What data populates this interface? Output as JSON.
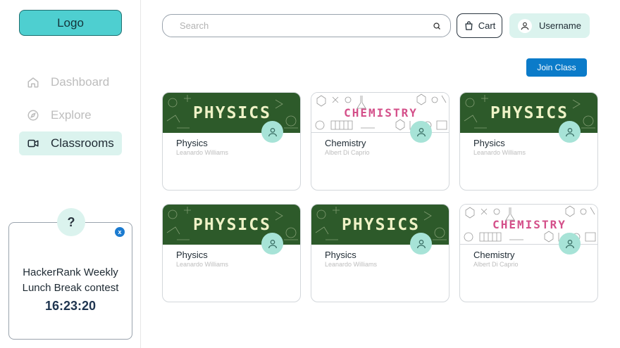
{
  "sidebar": {
    "logo": "Logo",
    "nav": [
      {
        "label": "Dashboard",
        "icon": "home-icon",
        "active": false
      },
      {
        "label": "Explore",
        "icon": "compass-icon",
        "active": false
      },
      {
        "label": "Classrooms",
        "icon": "video-icon",
        "active": true
      }
    ],
    "contest": {
      "help": "?",
      "close": "x",
      "title_line1": "HackerRank Weekly",
      "title_line2": "Lunch Break contest",
      "timer": "16:23:20"
    }
  },
  "header": {
    "search_placeholder": "Search",
    "cart_label": "Cart",
    "username": "Username"
  },
  "main": {
    "join_label": "Join Class",
    "cards": [
      {
        "banner": "PHYSICS",
        "theme": "physics",
        "subject": "Physics",
        "teacher": "Leanardo Williams"
      },
      {
        "banner": "CHEMISTRY",
        "theme": "chemistry",
        "subject": "Chemistry",
        "teacher": "Albert Di Caprio"
      },
      {
        "banner": "PHYSICS",
        "theme": "physics",
        "subject": "Physics",
        "teacher": "Leanardo Williams"
      },
      {
        "banner": "PHYSICS",
        "theme": "physics",
        "subject": "Physics",
        "teacher": "Leanardo Williams"
      },
      {
        "banner": "PHYSICS",
        "theme": "physics",
        "subject": "Physics",
        "teacher": "Leanardo Williams"
      },
      {
        "banner": "CHEMISTRY",
        "theme": "chemistry",
        "subject": "Chemistry",
        "teacher": "Albert Di Caprio"
      }
    ]
  },
  "colors": {
    "accent": "#4ecfd0",
    "active_bg": "#dbf3ee",
    "primary_button": "#0b7bc9",
    "physics_board": "#2d5a2a",
    "chemistry_text": "#d4508a"
  }
}
